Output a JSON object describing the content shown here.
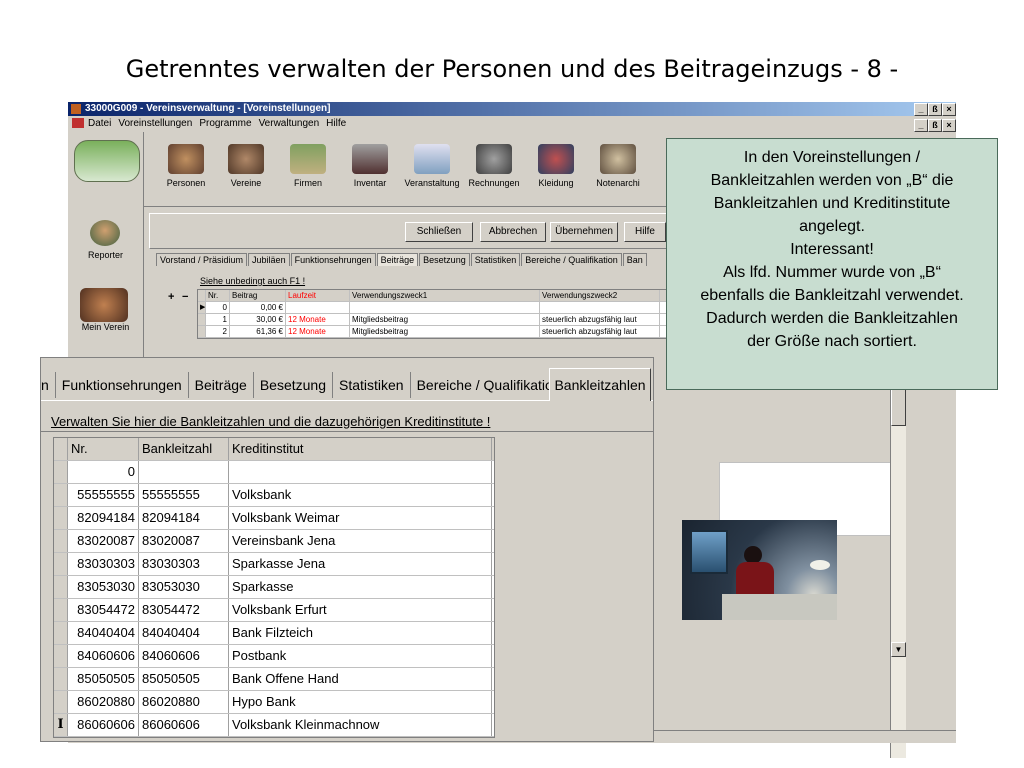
{
  "slide": {
    "title": "Getrenntes verwalten der Personen und des Beitrageinzugs - 8 -"
  },
  "window": {
    "title": "33000G009 - Vereinsverwaltung - [Voreinstellungen]",
    "minimize": "_",
    "restore": "ß",
    "close": "×"
  },
  "menu": [
    "Datei",
    "Voreinstellungen",
    "Programme",
    "Verwaltungen",
    "Hilfe"
  ],
  "leftpanel": {
    "reporter": "Reporter",
    "mein_verein": "Mein Verein"
  },
  "toolbar": [
    "Personen",
    "Vereine",
    "Firmen",
    "Inventar",
    "Veranstaltung",
    "Rechnungen",
    "Kleidung",
    "Notenarchi"
  ],
  "buttons": {
    "schliessen": "Schließen",
    "abbrechen": "Abbrechen",
    "uebernehmen": "Übernehmen",
    "hilfe": "Hilfe"
  },
  "small_tabs": [
    "Vorstand / Präsidium",
    "Jubiläen",
    "Funktionsehrungen",
    "Beiträge",
    "Besetzung",
    "Statistiken",
    "Bereiche / Qualifikation",
    "Ban"
  ],
  "small_hint": "Siehe unbedingt auch F1 !",
  "small_grid": {
    "headers": [
      "Nr.",
      "Beitrag",
      "Laufzeit",
      "Verwendungszweck1",
      "Verwendungszweck2"
    ],
    "rows": [
      [
        "0",
        "0,00 €",
        "",
        "",
        ""
      ],
      [
        "1",
        "30,00 €",
        "12 Monate",
        "Mitgliedsbeitrag",
        "steuerlich abzugsfähig laut"
      ],
      [
        "2",
        "61,36 €",
        "12 Monate",
        "Mitgliedsbeitrag",
        "steuerlich abzugsfähig laut"
      ]
    ]
  },
  "zoom": {
    "tabs": [
      "n",
      "Funktionsehrungen",
      "Beiträge",
      "Besetzung",
      "Statistiken",
      "Bereiche / Qualifikation"
    ],
    "active_tab": "Bankleitzahlen",
    "hint": "Verwalten Sie hier die Bankleitzahlen und die dazugehörigen Kreditinstitute !",
    "headers": [
      "Nr.",
      "Bankleitzahl",
      "Kreditinstitut"
    ],
    "rows": [
      [
        "0",
        "",
        ""
      ],
      [
        "55555555",
        "55555555",
        "Volksbank"
      ],
      [
        "82094184",
        "82094184",
        "Volksbank Weimar"
      ],
      [
        "83020087",
        "83020087",
        "Vereinsbank Jena"
      ],
      [
        "83030303",
        "83030303",
        "Sparkasse Jena"
      ],
      [
        "83053030",
        "83053030",
        "Sparkasse"
      ],
      [
        "83054472",
        "83054472",
        "Volksbank Erfurt"
      ],
      [
        "84040404",
        "84040404",
        "Bank Filzteich"
      ],
      [
        "84060606",
        "84060606",
        "Postbank"
      ],
      [
        "85050505",
        "85050505",
        "Bank Offene Hand"
      ],
      [
        "86020880",
        "86020880",
        "Hypo Bank"
      ],
      [
        "86060606",
        "86060606",
        "Volksbank Kleinmachnow"
      ]
    ],
    "cursor_glyph": "I"
  },
  "callout": [
    "In den Voreinstellungen /",
    "Bankleitzahlen werden von „B“ die",
    "Bankleitzahlen und Kreditinstitute",
    "angelegt.",
    "Interessant!",
    "Als lfd. Nummer wurde von „B“",
    "ebenfalls die Bankleitzahl verwendet.",
    "Dadurch werden die Bankleitzahlen",
    "der Größe nach sortiert."
  ],
  "colors": {
    "laufzeit": "#ff0000",
    "titlebar": "#0a246a",
    "callout": "#c8ddd0"
  }
}
